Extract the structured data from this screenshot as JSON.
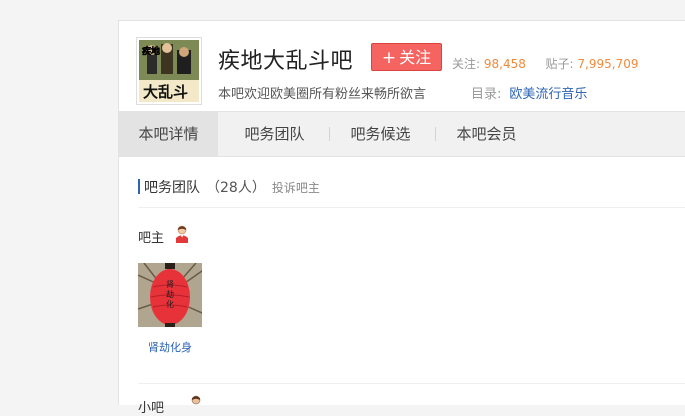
{
  "header": {
    "title": "疾地大乱斗吧",
    "follow_label": "关注",
    "follow_plus": "+",
    "followers_label": "关注:",
    "followers_value": "98,458",
    "posts_label": "贴子:",
    "posts_value": "7,995,709",
    "slogan": "本吧欢迎欧美圈所有粉丝来畅所欲言",
    "catalog_label": "目录:",
    "catalog_value": "欧美流行音乐",
    "avatar_text": "大乱斗",
    "avatar_badge": "疾地"
  },
  "tabs": [
    {
      "label": "本吧详情",
      "active": true
    },
    {
      "label": "吧务团队",
      "active": false
    },
    {
      "label": "吧务候选",
      "active": false
    },
    {
      "label": "本吧会员",
      "active": false
    }
  ],
  "team": {
    "title": "吧务团队",
    "count": "（28人）",
    "report": "投诉吧主",
    "owner_label": "吧主",
    "owners": [
      {
        "name": "肾劫化身",
        "avatar_text": "肾劫化身"
      }
    ],
    "next_label": "小吧"
  },
  "colors": {
    "follow_button": "#f56461",
    "link": "#2d64b3",
    "stat_number": "#f08a3c",
    "lantern": "#e8323a"
  }
}
